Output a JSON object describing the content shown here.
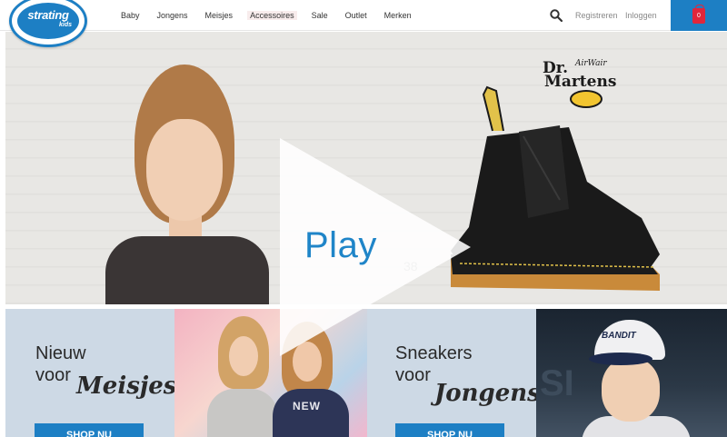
{
  "header": {
    "logo": {
      "name": "strating",
      "sub": "kids"
    },
    "nav": [
      "Baby",
      "Jongens",
      "Meisjes",
      "Accessoires",
      "Sale",
      "Outlet",
      "Merken"
    ],
    "account": {
      "register": "Registreren",
      "login": "Inloggen"
    },
    "cart": {
      "count": "0"
    }
  },
  "hero": {
    "brand": {
      "line1": "Dr.",
      "line2": "AirWair",
      "line3": "Martens"
    },
    "price_fragment": "38",
    "play_label": "Play"
  },
  "banners": [
    {
      "line1": "Nieuw",
      "line2": "voor",
      "script": "Meisjes",
      "button": "SHOP NU"
    },
    {
      "line1": "Sneakers",
      "line2": "voor",
      "script": "Jongens",
      "button": "SHOP NU"
    }
  ],
  "photos": {
    "girls_shirt_print": "NEW",
    "boy_cap_text": "BANDIT",
    "boy_bg_text": "SI"
  },
  "colors": {
    "accent": "#1d7fc4",
    "cart_bag": "#e0263c",
    "banner_bg": "#cdd9e5"
  }
}
